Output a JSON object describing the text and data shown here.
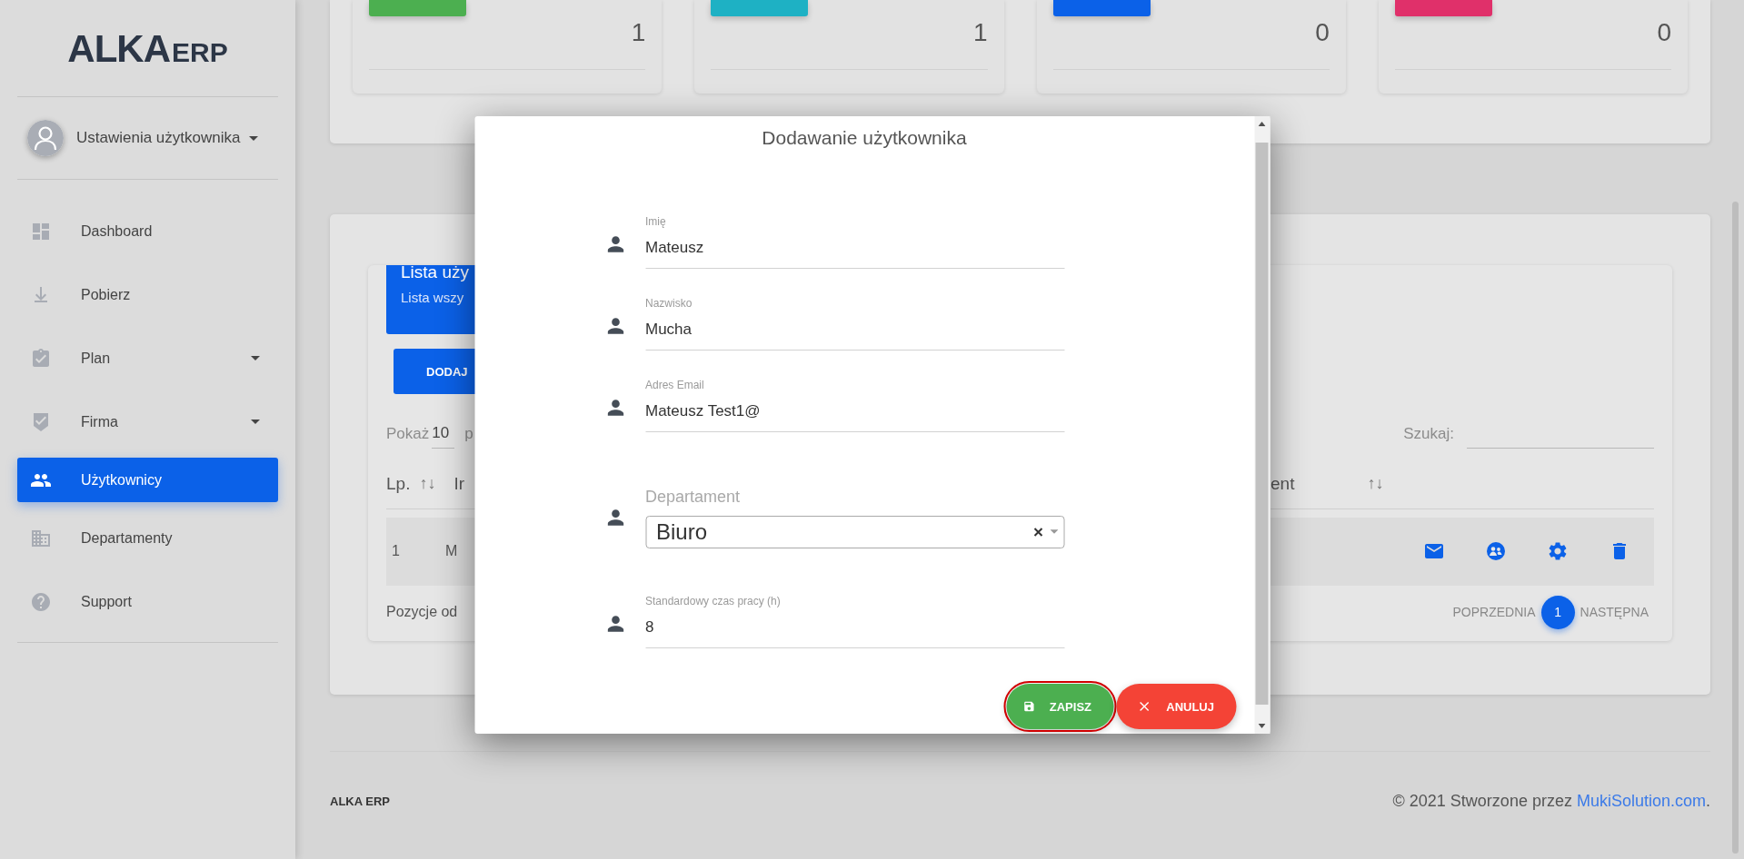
{
  "sidebar": {
    "logo": {
      "main": "ALKA",
      "suffix": "ERP"
    },
    "user_menu": {
      "label": "Ustawienia użytkownika"
    },
    "items": [
      {
        "label": "Dashboard",
        "selected": false,
        "has_submenu": false
      },
      {
        "label": "Pobierz",
        "selected": false,
        "has_submenu": false
      },
      {
        "label": "Plan",
        "selected": false,
        "has_submenu": true
      },
      {
        "label": "Firma",
        "selected": false,
        "has_submenu": true
      },
      {
        "label": "Użytkownicy",
        "selected": true,
        "has_submenu": false
      },
      {
        "label": "Departamenty",
        "selected": false,
        "has_submenu": false
      },
      {
        "label": "Support",
        "selected": false,
        "has_submenu": false
      }
    ]
  },
  "stat_cards": [
    {
      "value": "1",
      "color": "#4caf50"
    },
    {
      "value": "1",
      "color": "#1eb1c4"
    },
    {
      "value": "0",
      "color": "#0b61e8"
    },
    {
      "value": "0",
      "color": "#e0306a"
    }
  ],
  "users_panel": {
    "title": "Lista uży",
    "subtitle": "Lista wszy",
    "add_button": "DODAJ",
    "show_label": "Pokaż",
    "page_size": "10",
    "page_size_suffix": "p",
    "search_label": "Szukaj:",
    "columns_left": [
      {
        "label": "Lp.",
        "sort": "↑↓"
      },
      {
        "label": "Ir"
      }
    ],
    "column_right": {
      "label": "ent",
      "sort": "↑↓"
    },
    "rows": [
      {
        "cells": [
          "1",
          "M"
        ]
      }
    ],
    "info": "Pozycje od",
    "pagination": {
      "previous": "POPRZEDNIA",
      "pages": [
        {
          "label": "1",
          "selected": true
        }
      ],
      "next": "NASTĘPNA"
    }
  },
  "modal": {
    "title": "Dodawanie użytkownika",
    "fields": [
      {
        "kind": "text",
        "label": "Imię",
        "value": "Mateusz"
      },
      {
        "kind": "text",
        "label": "Nazwisko",
        "value": "Mucha"
      },
      {
        "kind": "text",
        "label": "Adres Email",
        "value": "Mateusz Test1@"
      },
      {
        "kind": "select",
        "label": "Departament",
        "value": "Biuro"
      },
      {
        "kind": "text",
        "label": "Standardowy czas pracy (h)",
        "value": "8"
      }
    ],
    "buttons": [
      {
        "kind": "save",
        "label": "ZAPISZ",
        "focused": true
      },
      {
        "kind": "cancel",
        "label": "ANULUJ",
        "focused": false
      }
    ]
  },
  "footer": {
    "brand": "ALKA ERP",
    "copyright": "© 2021 Stworzone przez ",
    "link": "MukiSolution.com",
    "suffix": "."
  }
}
